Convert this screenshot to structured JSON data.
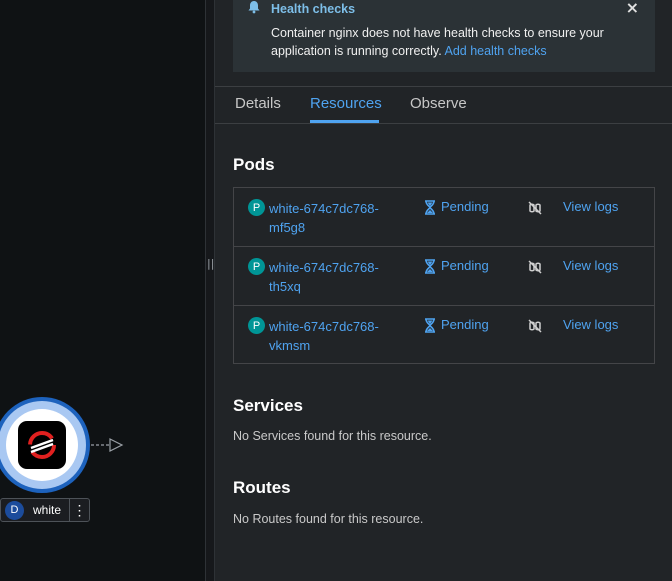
{
  "topology": {
    "node": {
      "badge": "D",
      "name": "white",
      "kebab": "⋮"
    }
  },
  "alert": {
    "title": "Health checks",
    "message": "Container nginx does not have health checks to ensure your application is running correctly.",
    "link": "Add health checks",
    "close": "×"
  },
  "tabs": [
    {
      "label": "Details",
      "active": false
    },
    {
      "label": "Resources",
      "active": true
    },
    {
      "label": "Observe",
      "active": false
    }
  ],
  "pods": {
    "title": "Pods",
    "rows": [
      {
        "badge": "P",
        "name": "white-674c7dc768-mf5g8",
        "status": "Pending",
        "logs": "View logs"
      },
      {
        "badge": "P",
        "name": "white-674c7dc768-th5xq",
        "status": "Pending",
        "logs": "View logs"
      },
      {
        "badge": "P",
        "name": "white-674c7dc768-vkmsm",
        "status": "Pending",
        "logs": "View logs"
      }
    ]
  },
  "services": {
    "title": "Services",
    "empty": "No Services found for this resource."
  },
  "routes": {
    "title": "Routes",
    "empty": "No Routes found for this resource."
  },
  "colors": {
    "accent": "#4fa3f0",
    "pod_badge": "#009596",
    "deployment_badge": "#1c4c9c"
  }
}
